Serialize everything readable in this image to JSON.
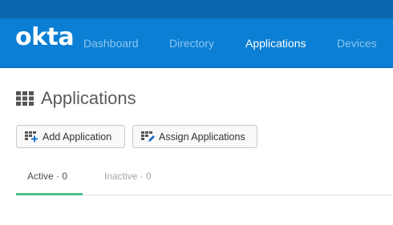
{
  "navbar": {
    "logo": "okta",
    "items": [
      {
        "label": "Dashboard",
        "active": false
      },
      {
        "label": "Directory",
        "active": false
      },
      {
        "label": "Applications",
        "active": true
      },
      {
        "label": "Devices",
        "active": false
      }
    ]
  },
  "page": {
    "title": "Applications",
    "title_icon": "grid-icon"
  },
  "actions": {
    "add_label": "Add Application",
    "add_icon": "grid-add-icon",
    "assign_label": "Assign Applications",
    "assign_icon": "grid-assign-icon"
  },
  "tabs": [
    {
      "label": "Active · 0",
      "active": true
    },
    {
      "label": "Inactive · 0",
      "active": false
    }
  ],
  "colors": {
    "nav_background": "#0a7fd3",
    "top_strip": "#0b67b0",
    "active_tab_underline": "#4dbd8c"
  }
}
